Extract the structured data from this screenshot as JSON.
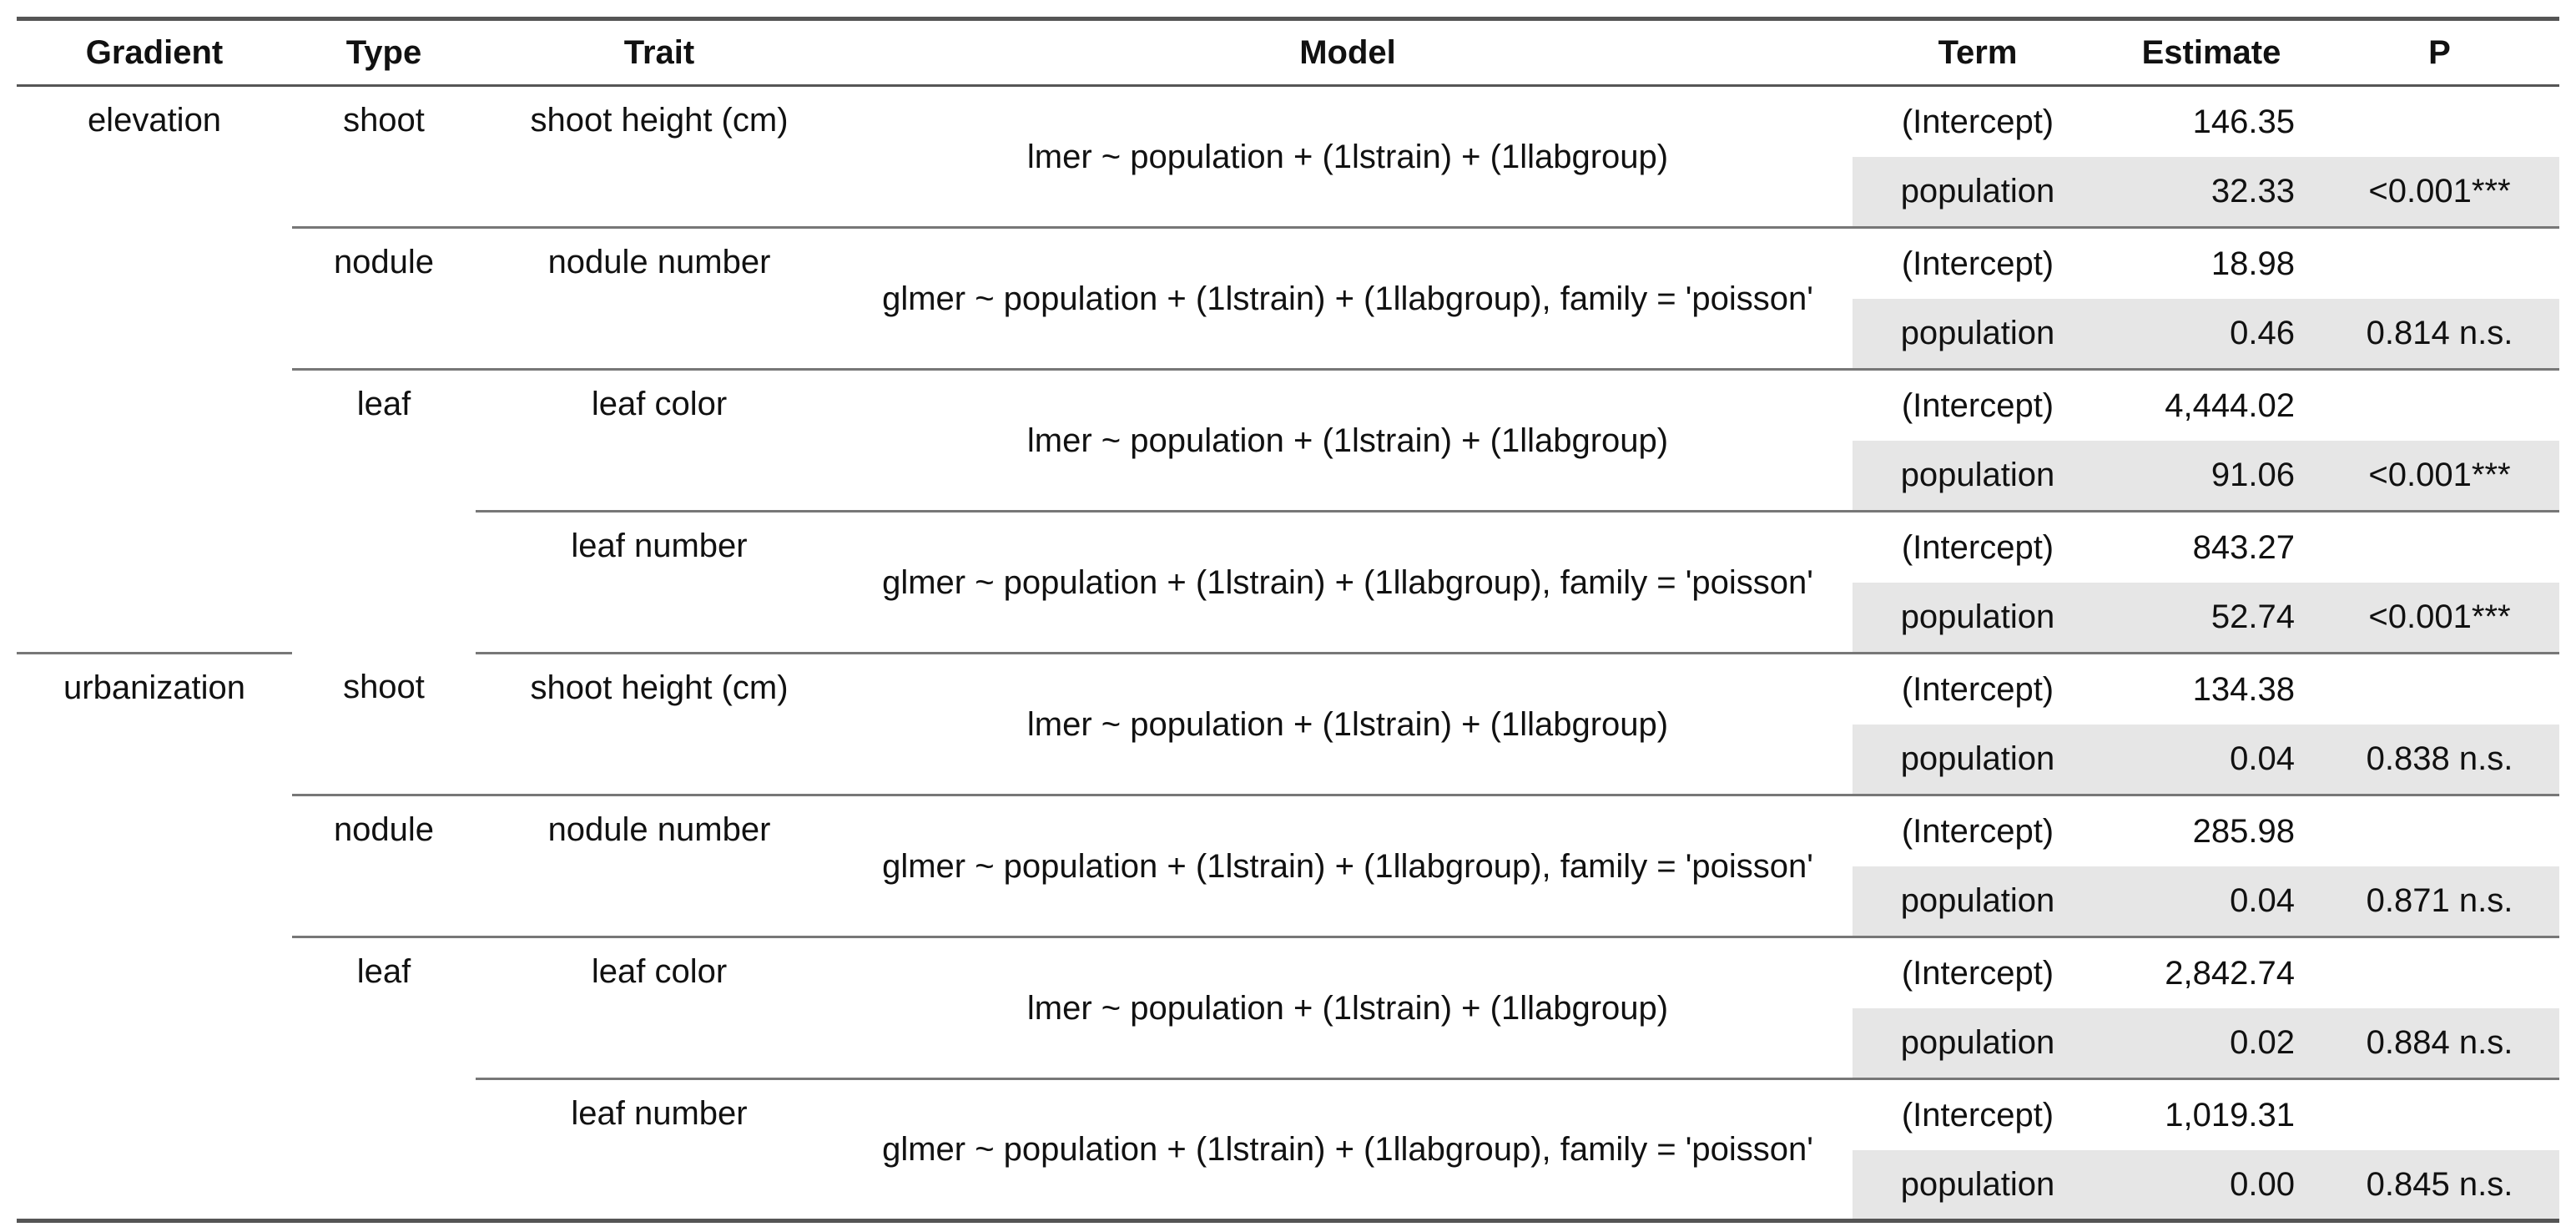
{
  "headers": {
    "gradient": "Gradient",
    "type": "Type",
    "trait": "Trait",
    "model": "Model",
    "term": "Term",
    "estimate": "Estimate",
    "p": "P"
  },
  "groups": [
    {
      "gradient": "elevation",
      "types": [
        {
          "type": "shoot",
          "traits": [
            {
              "trait": "shoot height (cm)",
              "model": "lmer ~ population + (1lstrain) + (1llabgroup)",
              "terms": [
                {
                  "term": "(Intercept)",
                  "estimate": "146.35",
                  "p": ""
                },
                {
                  "term": "population",
                  "estimate": "32.33",
                  "p": "<0.001***"
                }
              ]
            }
          ]
        },
        {
          "type": "nodule",
          "traits": [
            {
              "trait": "nodule number",
              "model": "glmer ~ population + (1lstrain) + (1llabgroup), family = 'poisson'",
              "terms": [
                {
                  "term": "(Intercept)",
                  "estimate": "18.98",
                  "p": ""
                },
                {
                  "term": "population",
                  "estimate": "0.46",
                  "p": "0.814 n.s."
                }
              ]
            }
          ]
        },
        {
          "type": "leaf",
          "traits": [
            {
              "trait": "leaf color",
              "model": "lmer ~ population + (1lstrain) + (1llabgroup)",
              "terms": [
                {
                  "term": "(Intercept)",
                  "estimate": "4,444.02",
                  "p": ""
                },
                {
                  "term": "population",
                  "estimate": "91.06",
                  "p": "<0.001***"
                }
              ]
            },
            {
              "trait": "leaf number",
              "model": "glmer ~ population + (1lstrain) + (1llabgroup), family = 'poisson'",
              "terms": [
                {
                  "term": "(Intercept)",
                  "estimate": "843.27",
                  "p": ""
                },
                {
                  "term": "population",
                  "estimate": "52.74",
                  "p": "<0.001***"
                }
              ]
            }
          ]
        }
      ]
    },
    {
      "gradient": "urbanization",
      "types": [
        {
          "type": "shoot",
          "traits": [
            {
              "trait": "shoot height (cm)",
              "model": "lmer ~ population + (1lstrain) + (1llabgroup)",
              "terms": [
                {
                  "term": "(Intercept)",
                  "estimate": "134.38",
                  "p": ""
                },
                {
                  "term": "population",
                  "estimate": "0.04",
                  "p": "0.838 n.s."
                }
              ]
            }
          ]
        },
        {
          "type": "nodule",
          "traits": [
            {
              "trait": "nodule number",
              "model": "glmer ~ population + (1lstrain) + (1llabgroup), family = 'poisson'",
              "terms": [
                {
                  "term": "(Intercept)",
                  "estimate": "285.98",
                  "p": ""
                },
                {
                  "term": "population",
                  "estimate": "0.04",
                  "p": "0.871 n.s."
                }
              ]
            }
          ]
        },
        {
          "type": "leaf",
          "traits": [
            {
              "trait": "leaf color",
              "model": "lmer ~ population + (1lstrain) + (1llabgroup)",
              "terms": [
                {
                  "term": "(Intercept)",
                  "estimate": "2,842.74",
                  "p": ""
                },
                {
                  "term": "population",
                  "estimate": "0.02",
                  "p": "0.884 n.s."
                }
              ]
            },
            {
              "trait": "leaf number",
              "model": "glmer ~ population + (1lstrain) + (1llabgroup), family = 'poisson'",
              "terms": [
                {
                  "term": "(Intercept)",
                  "estimate": "1,019.31",
                  "p": ""
                },
                {
                  "term": "population",
                  "estimate": "0.00",
                  "p": "0.845 n.s."
                }
              ]
            }
          ]
        }
      ]
    }
  ]
}
